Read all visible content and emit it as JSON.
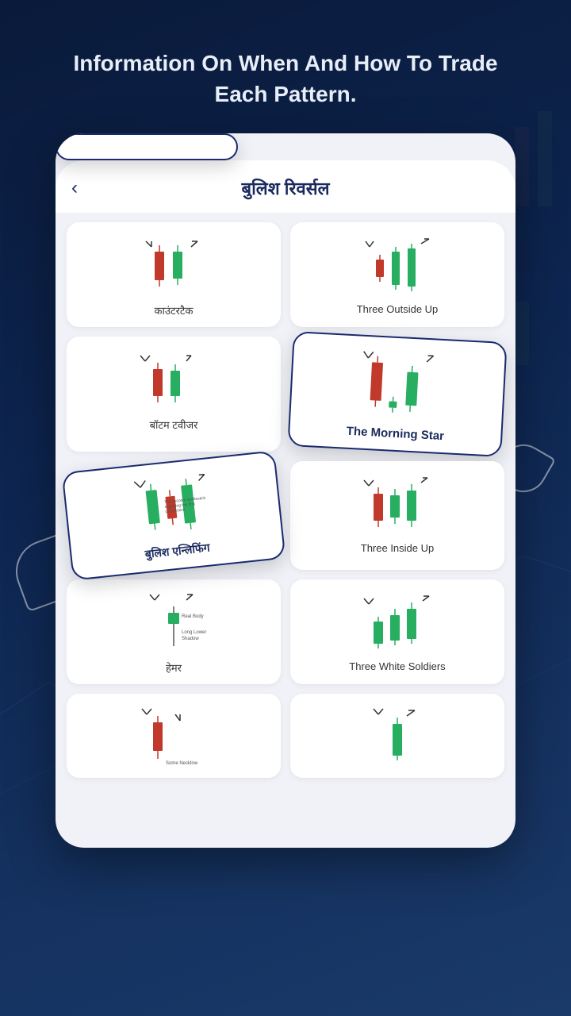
{
  "header": {
    "title": "Information On When And How To Trade Each Pattern."
  },
  "app": {
    "back_label": "‹",
    "page_title": "बुलिश रिवर्सल"
  },
  "cards": [
    {
      "id": "counterattack",
      "label": "काउंटरटैक"
    },
    {
      "id": "three-outside-up",
      "label": "Three Outside Up"
    },
    {
      "id": "bottom-tweezers",
      "label": "बॉटम टवीजर"
    },
    {
      "id": "morning-star",
      "label": "The Morning Star"
    },
    {
      "id": "bullish-engulfing",
      "label": "बुलिश एन्लिफिंग"
    },
    {
      "id": "three-inside-up",
      "label": "Three Inside Up"
    },
    {
      "id": "hammer",
      "label": "हेमर"
    },
    {
      "id": "three-white-soldiers",
      "label": "Three White Soldiers"
    },
    {
      "id": "bottom-row-left",
      "label": ""
    },
    {
      "id": "bottom-row-right",
      "label": ""
    }
  ]
}
